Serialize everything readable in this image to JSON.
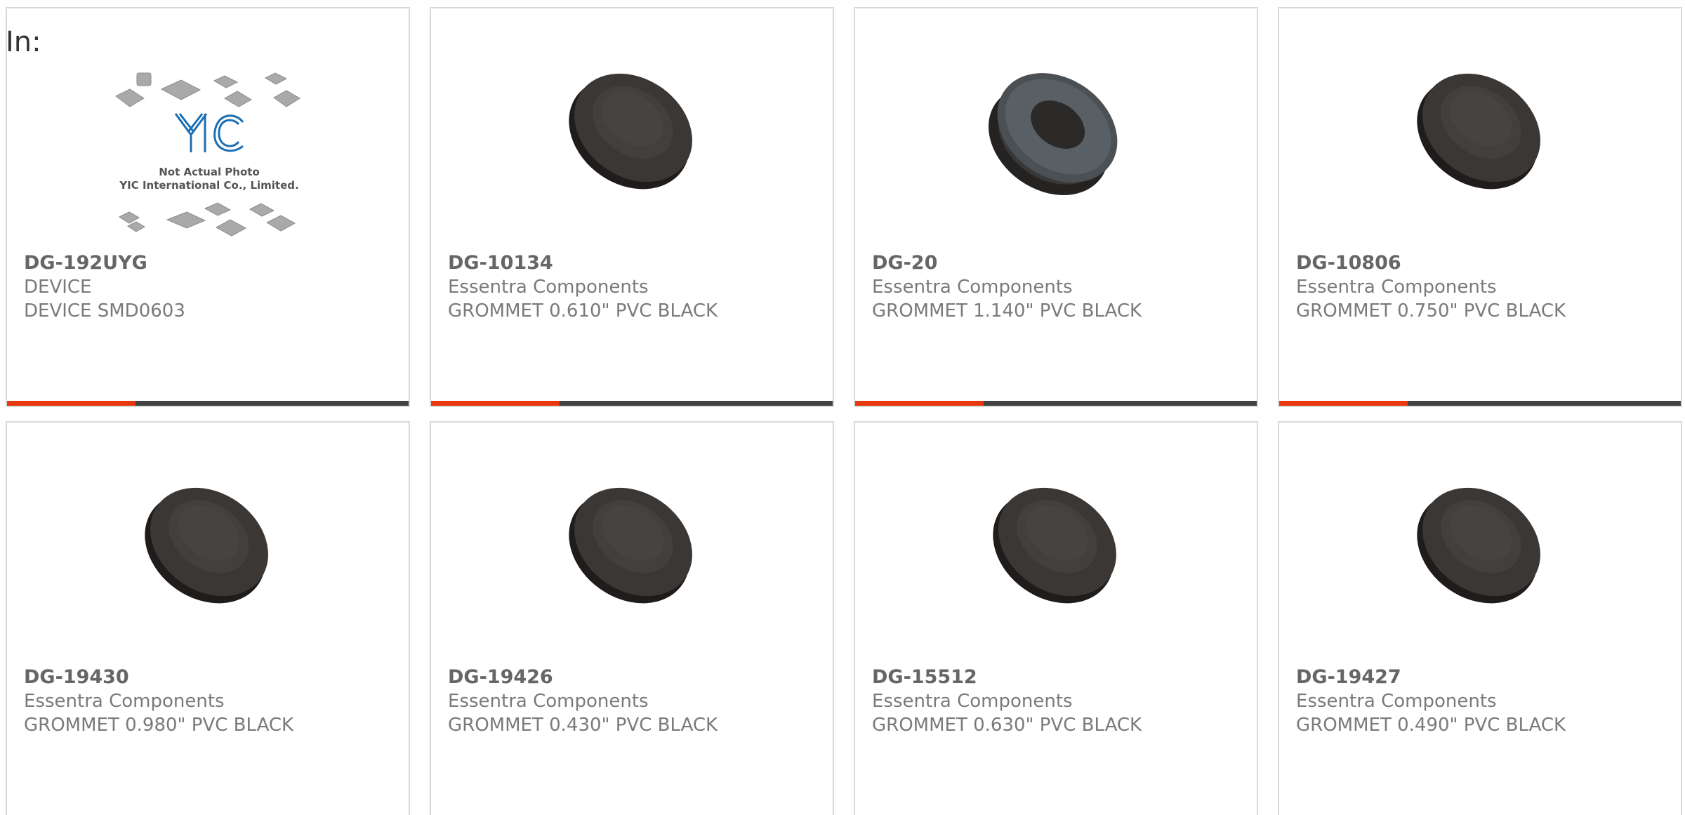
{
  "header": {
    "in_label": "In:"
  },
  "placeholder": {
    "line1": "Not Actual Photo",
    "line2": "YIC International Co., Limited."
  },
  "colors": {
    "accent": "#e8380d",
    "bar": "#3f4142",
    "card_border": "#d9d9d9",
    "grommet": "#3b3735"
  },
  "products": [
    {
      "part": "DG-192UYG",
      "manufacturer": "DEVICE",
      "description": "DEVICE SMD0603",
      "image": "not-actual-photo"
    },
    {
      "part": "DG-10134",
      "manufacturer": "Essentra Components",
      "description": "GROMMET 0.610\" PVC BLACK",
      "image": "grommet"
    },
    {
      "part": "DG-20",
      "manufacturer": "Essentra Components",
      "description": "GROMMET 1.140\" PVC BLACK",
      "image": "grommet-ring"
    },
    {
      "part": "DG-10806",
      "manufacturer": "Essentra Components",
      "description": "GROMMET 0.750\" PVC BLACK",
      "image": "grommet"
    },
    {
      "part": "DG-19430",
      "manufacturer": "Essentra Components",
      "description": "GROMMET 0.980\" PVC BLACK",
      "image": "grommet"
    },
    {
      "part": "DG-19426",
      "manufacturer": "Essentra Components",
      "description": "GROMMET 0.430\" PVC BLACK",
      "image": "grommet"
    },
    {
      "part": "DG-15512",
      "manufacturer": "Essentra Components",
      "description": "GROMMET 0.630\" PVC BLACK",
      "image": "grommet"
    },
    {
      "part": "DG-19427",
      "manufacturer": "Essentra Components",
      "description": "GROMMET 0.490\" PVC BLACK",
      "image": "grommet"
    }
  ]
}
